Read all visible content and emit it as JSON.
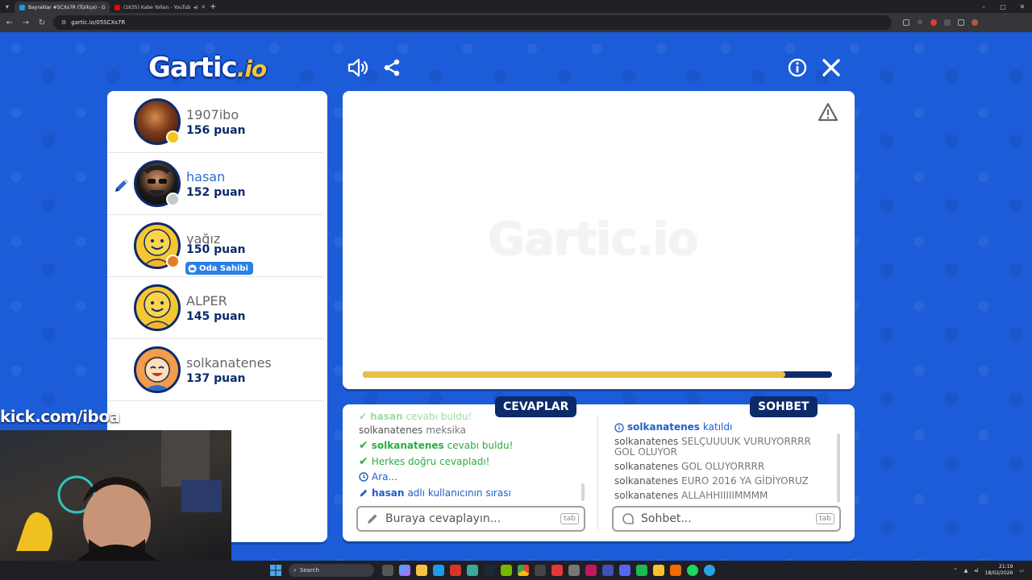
{
  "browser": {
    "tabs": [
      {
        "title": "Bayraklar #5CXs7R (Türkçe) - G",
        "active": true,
        "favicon_color": "#1c9be6"
      },
      {
        "title": "(1635) Kabe Yolları - YouTub",
        "active": false,
        "favicon_color": "#ff0000"
      }
    ],
    "url": "gartic.io/05SCXs7R",
    "new_tab": "+",
    "controls": {
      "minimize": "–",
      "maximize": "▢",
      "close": "✕"
    }
  },
  "game": {
    "logo_main": "Gartic",
    "logo_suffix": ".io",
    "watermark": "Gartic.io",
    "timer_progress": 0.9,
    "players": [
      {
        "name": "1907ibo",
        "score": "156 puan",
        "status_color": "#f5c518",
        "avatar_bg": "#5a2a18",
        "current": false,
        "badge": ""
      },
      {
        "name": "hasan",
        "score": "152 puan",
        "status_color": "#c8c8c8",
        "avatar_bg": "#1c1c1c",
        "current": true,
        "badge": ""
      },
      {
        "name": "yağız",
        "score": "150 puan",
        "status_color": "#e67e22",
        "avatar_bg": "#f7c62f",
        "current": false,
        "badge": "Oda Sahibi"
      },
      {
        "name": "ALPER",
        "score": "145 puan",
        "status_color": "",
        "avatar_bg": "#f7c62f",
        "current": false,
        "badge": ""
      },
      {
        "name": "solkanatenes",
        "score": "137 puan",
        "status_color": "",
        "avatar_bg": "#f39c4a",
        "current": false,
        "badge": ""
      }
    ],
    "answers_tab": "CEVAPLAR",
    "chat_tab": "SOHBET",
    "answers_feed": [
      {
        "user": "hasan",
        "text": "cevabı buldu!",
        "type": "found-faded"
      },
      {
        "user": "solkanatenes",
        "text": "meksika",
        "type": "guess"
      },
      {
        "user": "solkanatenes",
        "text": "cevabı buldu!",
        "type": "found"
      },
      {
        "user": "",
        "text": "Herkes doğru cevapladı!",
        "type": "all"
      },
      {
        "user": "",
        "text": "Ara...",
        "type": "break"
      },
      {
        "user": "hasan",
        "text": "adlı kullanıcının sırası",
        "type": "turn"
      }
    ],
    "chat_feed": [
      {
        "user": "solkanatenes",
        "text": "katıldı",
        "type": "join"
      },
      {
        "user": "solkanatenes",
        "text": "SELÇUUUUK VURUYORRRR GOL OLUYOR",
        "type": "msg"
      },
      {
        "user": "solkanatenes",
        "text": "GOL OLUYORRRR",
        "type": "msg"
      },
      {
        "user": "solkanatenes",
        "text": "EURO 2016 YA GİDİYORUZ",
        "type": "msg"
      },
      {
        "user": "solkanatenes",
        "text": "ALLAHHIIIIIMMMM",
        "type": "msg"
      }
    ],
    "answer_placeholder": "Buraya cevaplayın...",
    "chat_placeholder": "Sohbet...",
    "tab_key": "tab"
  },
  "overlay": {
    "kick_text": "kick.com/iboa"
  },
  "taskbar": {
    "search_label": "Search",
    "time": "21:19",
    "date": "18/02/2026"
  },
  "colors": {
    "background": "#1c5cd8",
    "navy": "#0d2a6b",
    "accent_blue": "#2a6bd4",
    "timer_yellow": "#e8c048",
    "success_green": "#27ae3f"
  }
}
